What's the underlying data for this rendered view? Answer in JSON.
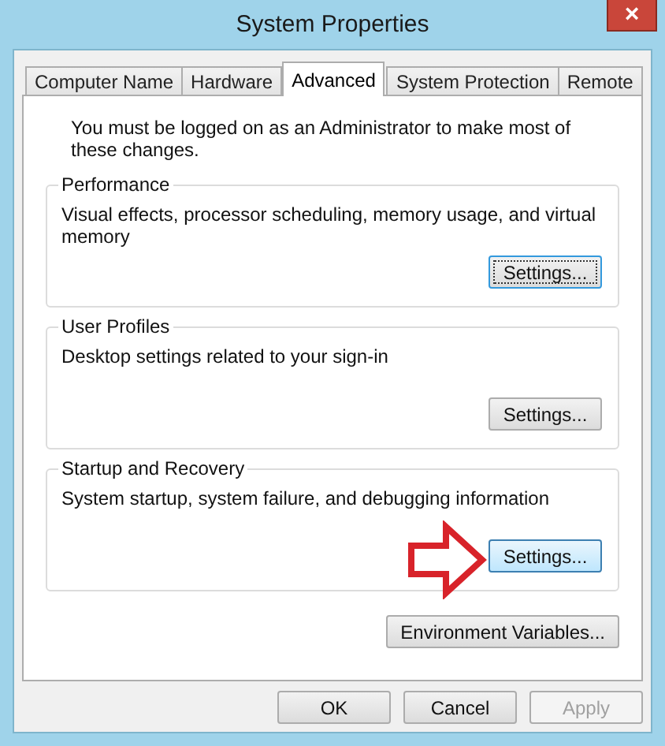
{
  "window": {
    "title": "System Properties",
    "close": "×"
  },
  "tabs": [
    {
      "label": "Computer Name",
      "selected": false
    },
    {
      "label": "Hardware",
      "selected": false
    },
    {
      "label": "Advanced",
      "selected": true
    },
    {
      "label": "System Protection",
      "selected": false
    },
    {
      "label": "Remote",
      "selected": false
    }
  ],
  "notice": "You must be logged on as an Administrator to make most of these changes.",
  "groups": [
    {
      "title": "Performance",
      "description": "Visual effects, processor scheduling, memory usage, and virtual memory",
      "button": {
        "label": "Settings...",
        "focused": true,
        "hovered": false
      }
    },
    {
      "title": "User Profiles",
      "description": "Desktop settings related to your sign-in",
      "button": {
        "label": "Settings...",
        "focused": false,
        "hovered": false
      }
    },
    {
      "title": "Startup and Recovery",
      "description": "System startup, system failure, and debugging information",
      "button": {
        "label": "Settings...",
        "focused": false,
        "hovered": true
      }
    }
  ],
  "environment_button": {
    "label": "Environment Variables..."
  },
  "buttons": [
    {
      "label": "OK",
      "disabled": false
    },
    {
      "label": "Cancel",
      "disabled": false
    },
    {
      "label": "Apply",
      "disabled": true
    }
  ]
}
